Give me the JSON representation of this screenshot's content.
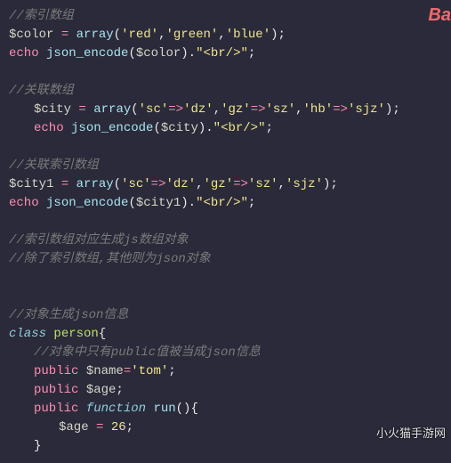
{
  "banner": "Ba",
  "watermark": "小火猫手游网",
  "lines": {
    "l1": "//索引数组",
    "l2a": "$color",
    "l2b": " = ",
    "l2c": "array",
    "l2d": "(",
    "l2e": "'red'",
    "l2f": ",",
    "l2g": "'green'",
    "l2h": ",",
    "l2i": "'blue'",
    "l2j": ");",
    "l3a": "echo ",
    "l3b": "json_encode",
    "l3c": "(",
    "l3d": "$color",
    "l3e": ").",
    "l3f": "\"<br/>\"",
    "l3g": ";",
    "l5": "//关联数组",
    "l6a": "$city",
    "l6b": " = ",
    "l6c": "array",
    "l6d": "(",
    "l6e": "'sc'",
    "l6f": "=>",
    "l6g": "'dz'",
    "l6h": ",",
    "l6i": "'gz'",
    "l6j": "=>",
    "l6k": "'sz'",
    "l6l": ",",
    "l6m": "'hb'",
    "l6n": "=>",
    "l6o": "'sjz'",
    "l6p": ");",
    "l7a": "echo ",
    "l7b": "json_encode",
    "l7c": "(",
    "l7d": "$city",
    "l7e": ").",
    "l7f": "\"<br/>\"",
    "l7g": ";",
    "l9": "//关联索引数组",
    "l10a": "$city1",
    "l10b": " = ",
    "l10c": "array",
    "l10d": "(",
    "l10e": "'sc'",
    "l10f": "=>",
    "l10g": "'dz'",
    "l10h": ",",
    "l10i": "'gz'",
    "l10j": "=>",
    "l10k": "'sz'",
    "l10l": ",",
    "l10m": "'sjz'",
    "l10n": ");",
    "l11a": "echo ",
    "l11b": "json_encode",
    "l11c": "(",
    "l11d": "$city1",
    "l11e": ").",
    "l11f": "\"<br/>\"",
    "l11g": ";",
    "l13": "//索引数组对应生成js数组对象",
    "l14": "//除了索引数组,其他则为json对象",
    "l17": "//对象生成json信息",
    "l18a": "class ",
    "l18b": "person",
    "l18c": "{",
    "l19": "//对象中只有public值被当成json信息",
    "l20a": "public ",
    "l20b": "$name",
    "l20c": "=",
    "l20d": "'tom'",
    "l20e": ";",
    "l21a": "public ",
    "l21b": "$age",
    "l21c": ";",
    "l22a": "public ",
    "l22b": "function ",
    "l22c": "run",
    "l22d": "(){",
    "l23a": "$age",
    "l23b": " = ",
    "l23c": "26",
    "l23d": ";",
    "l24": "}"
  }
}
